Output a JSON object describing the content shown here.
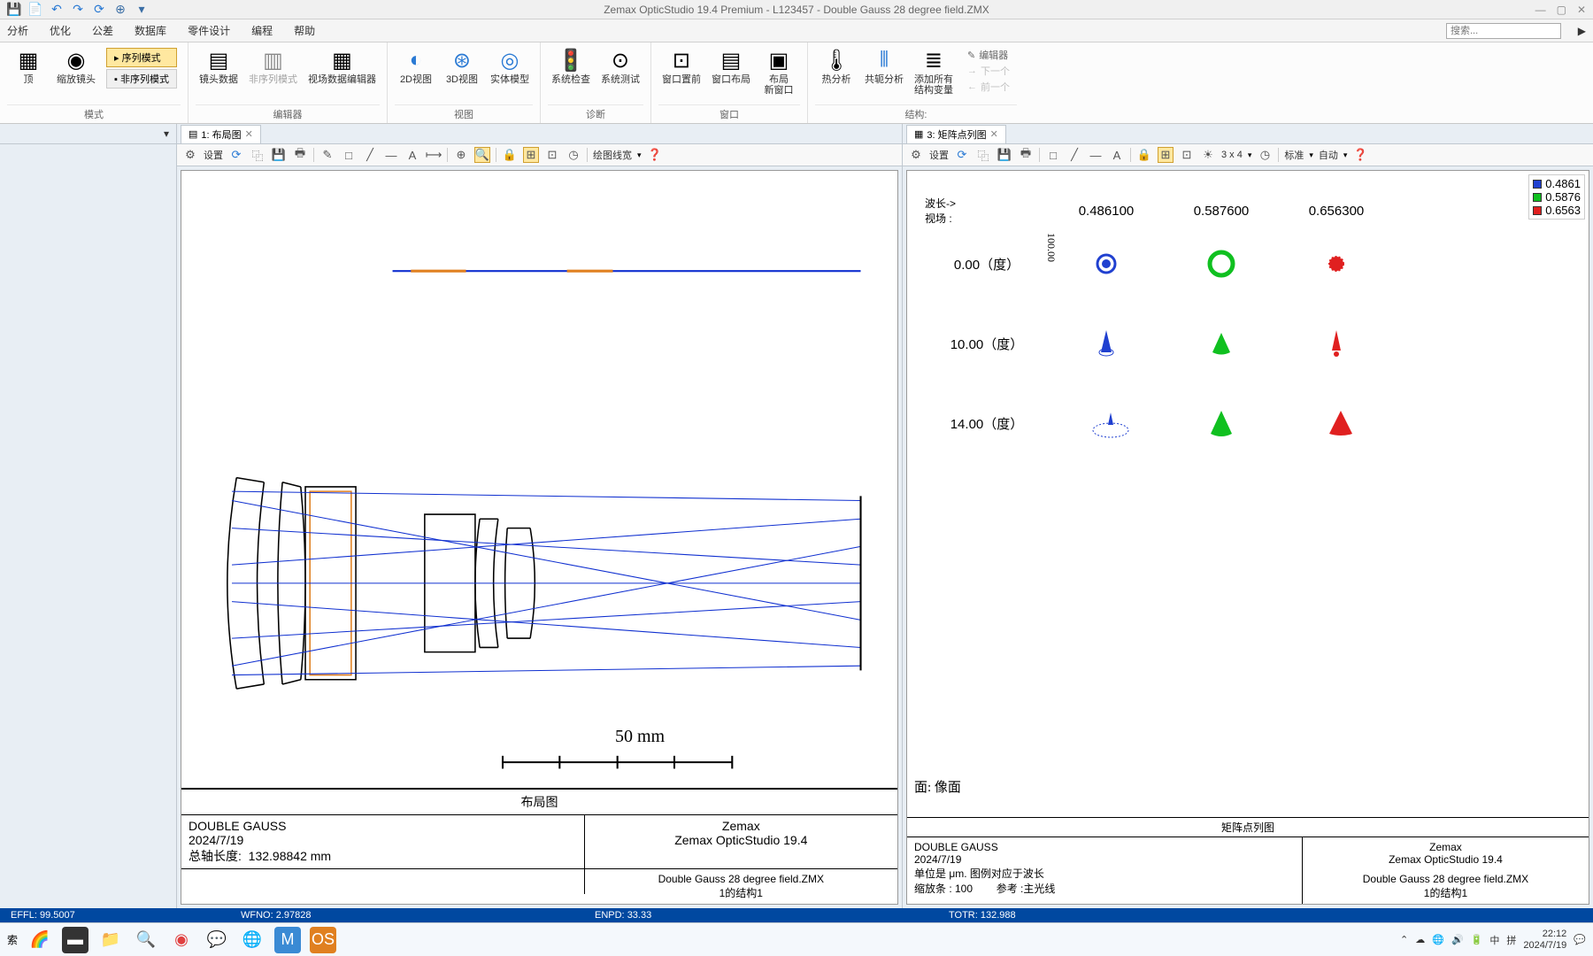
{
  "title": "Zemax OpticStudio 19.4    Premium - L123457 - Double Gauss 28 degree field.ZMX",
  "menu": [
    "分析",
    "优化",
    "公差",
    "数据库",
    "零件设计",
    "编程",
    "帮助"
  ],
  "search_placeholder": "搜索...",
  "ribbon": {
    "g1": {
      "label": "模式",
      "btns": [
        {
          "l": "顶"
        },
        {
          "l": "缩放镜头"
        }
      ],
      "mode_on": "序列模式",
      "mode_off": "非序列模式"
    },
    "g2": {
      "label": "编辑器",
      "btns": [
        {
          "l": "镜头数据"
        },
        {
          "l": "非序列模式"
        },
        {
          "l": "视场数据编辑器"
        }
      ]
    },
    "g3": {
      "label": "视图",
      "btns": [
        {
          "l": "2D视图"
        },
        {
          "l": "3D视图"
        },
        {
          "l": "实体模型"
        }
      ]
    },
    "g4": {
      "label": "诊断",
      "btns": [
        {
          "l": "系统检查"
        },
        {
          "l": "系统测试"
        }
      ]
    },
    "g5": {
      "label": "窗口",
      "btns": [
        {
          "l": "窗口置前"
        },
        {
          "l": "窗口布局"
        },
        {
          "l": "布局\n新窗口"
        }
      ]
    },
    "g6": {
      "label": "结构:",
      "btns": [
        {
          "l": "热分析"
        },
        {
          "l": "共轭分析"
        },
        {
          "l": "添加所有\n结构变量"
        }
      ],
      "side": [
        "编辑器",
        "下一个",
        "前一个"
      ]
    }
  },
  "layout": {
    "tab": "1: 布局图",
    "settings": "设置",
    "linew": "绘图线宽",
    "title": "布局图",
    "name": "DOUBLE GAUSS",
    "date": "2024/7/19",
    "total_len_lbl": "总轴长度:",
    "total_len_val": "132.98842 mm",
    "brand": "Zemax",
    "product": "Zemax OpticStudio 19.4",
    "file": "Double Gauss 28 degree field.ZMX",
    "config": "1的结构1",
    "scale": "50 mm"
  },
  "spot": {
    "tab": "3: 矩阵点列图",
    "settings": "设置",
    "std": "标准",
    "auto": "自动",
    "grid": "3 x 4",
    "wave_lbl": "波长->",
    "field_lbl": "视场    :",
    "waves": [
      "0.486100",
      "0.587600",
      "0.656300"
    ],
    "fields": [
      "0.00（度）",
      "10.00（度）",
      "14.00（度）"
    ],
    "scale": "100.00",
    "legend": [
      "0.4861",
      "0.5876",
      "0.6563"
    ],
    "surf": "面: 像面",
    "title": "矩阵点列图",
    "name": "DOUBLE GAUSS",
    "date": "2024/7/19",
    "unit": "单位是 μm. 图例对应于波长",
    "scale_lbl": "缩放条   :      100",
    "ref": "参考   :主光线",
    "brand": "Zemax",
    "product": "Zemax OpticStudio 19.4",
    "file": "Double Gauss 28 degree field.ZMX",
    "config": "1的结构1"
  },
  "status": [
    {
      "l": "EFFL:",
      "v": "99.5007"
    },
    {
      "l": "WFNO:",
      "v": "2.97828"
    },
    {
      "l": "ENPD:",
      "v": "33.33"
    },
    {
      "l": "TOTR:",
      "v": "132.988"
    }
  ],
  "taskbar": {
    "search": "索",
    "ime": [
      "中",
      "拼"
    ],
    "time": "22:12",
    "date": "2024/7/19"
  },
  "chart_data": {
    "layout_diagram": {
      "type": "optical-layout",
      "title": "布局图",
      "system": "DOUBLE GAUSS",
      "total_track_mm": 132.98842,
      "scale_bar_mm": 50,
      "fields_deg": [
        0.0,
        10.0,
        14.0
      ],
      "wavelengths_um": [
        0.4861,
        0.5876,
        0.6563
      ]
    },
    "spot_matrix": {
      "type": "spot-matrix",
      "title": "矩阵点列图",
      "surface": "像面",
      "scale_bar_um": 100,
      "reference": "主光线",
      "rows_fields_deg": [
        0.0,
        10.0,
        14.0
      ],
      "cols_wavelengths_um": [
        0.4861,
        0.5876,
        0.6563
      ],
      "colors": [
        "#2040d0",
        "#10c020",
        "#e02020"
      ]
    }
  }
}
